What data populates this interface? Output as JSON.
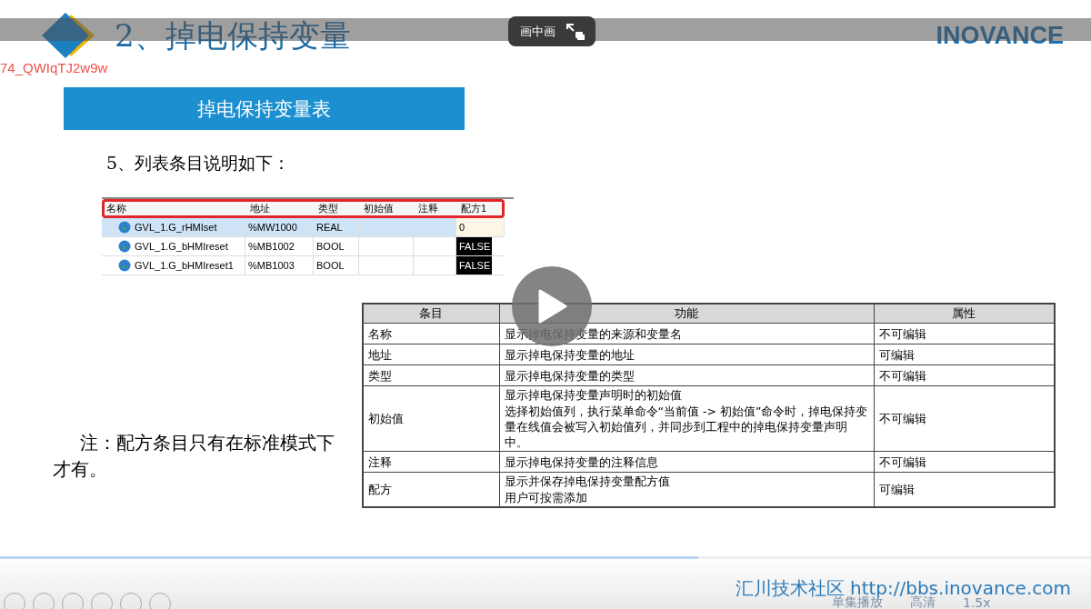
{
  "header": {
    "title": "2、掉电保持变量",
    "logo_text": "INOVANCE"
  },
  "overlay": {
    "video_id": "74_QWIqTJ2w9w",
    "pip_label": "画中画"
  },
  "banner": "掉电保持变量表",
  "intro": "5、列表条目说明如下：",
  "variable_table": {
    "columns": [
      "名称",
      "地址",
      "类型",
      "初始值",
      "注释",
      "配方1"
    ],
    "rows": [
      {
        "name": "GVL_1.G_rHMIset",
        "address": "%MW1000",
        "type": "REAL",
        "recipe": "0",
        "kind": "number",
        "selected": true
      },
      {
        "name": "GVL_1.G_bHMIreset",
        "address": "%MB1002",
        "type": "BOOL",
        "recipe": "FALSE",
        "kind": "bool",
        "selected": false
      },
      {
        "name": "GVL_1.G_bHMIreset1",
        "address": "%MB1003",
        "type": "BOOL",
        "recipe": "FALSE",
        "kind": "bool",
        "selected": false
      }
    ]
  },
  "description_table": {
    "columns": [
      "条目",
      "功能",
      "属性"
    ],
    "rows": [
      {
        "item": "名称",
        "function": [
          "显示掉电保持变量的来源和变量名"
        ],
        "property": "不可编辑"
      },
      {
        "item": "地址",
        "function": [
          "显示掉电保持变量的地址"
        ],
        "property": "可编辑"
      },
      {
        "item": "类型",
        "function": [
          "显示掉电保持变量的类型"
        ],
        "property": "不可编辑"
      },
      {
        "item": "初始值",
        "function": [
          "显示掉电保持变量声明时的初始值",
          "选择初始值列，执行菜单命令“当前值 -> 初始值”命令时，掉电保持变量在线值会被写入初始值列，并同步到工程中的掉电保持变量声明中。"
        ],
        "property": "不可编辑"
      },
      {
        "item": "注释",
        "function": [
          "显示掉电保持变量的注释信息"
        ],
        "property": "不可编辑"
      },
      {
        "item": "配方",
        "function": [
          "显示并保存掉电保持变量配方值",
          "用户可按需添加"
        ],
        "property": "可编辑"
      }
    ]
  },
  "note": "注：配方条目只有在标准模式下才有。",
  "footer": "汇川技术社区 http://bbs.inovance.com",
  "player": {
    "progress": {
      "level": 0.64
    },
    "buttons": [
      "单集播放",
      "高清",
      "1.5x"
    ]
  }
}
